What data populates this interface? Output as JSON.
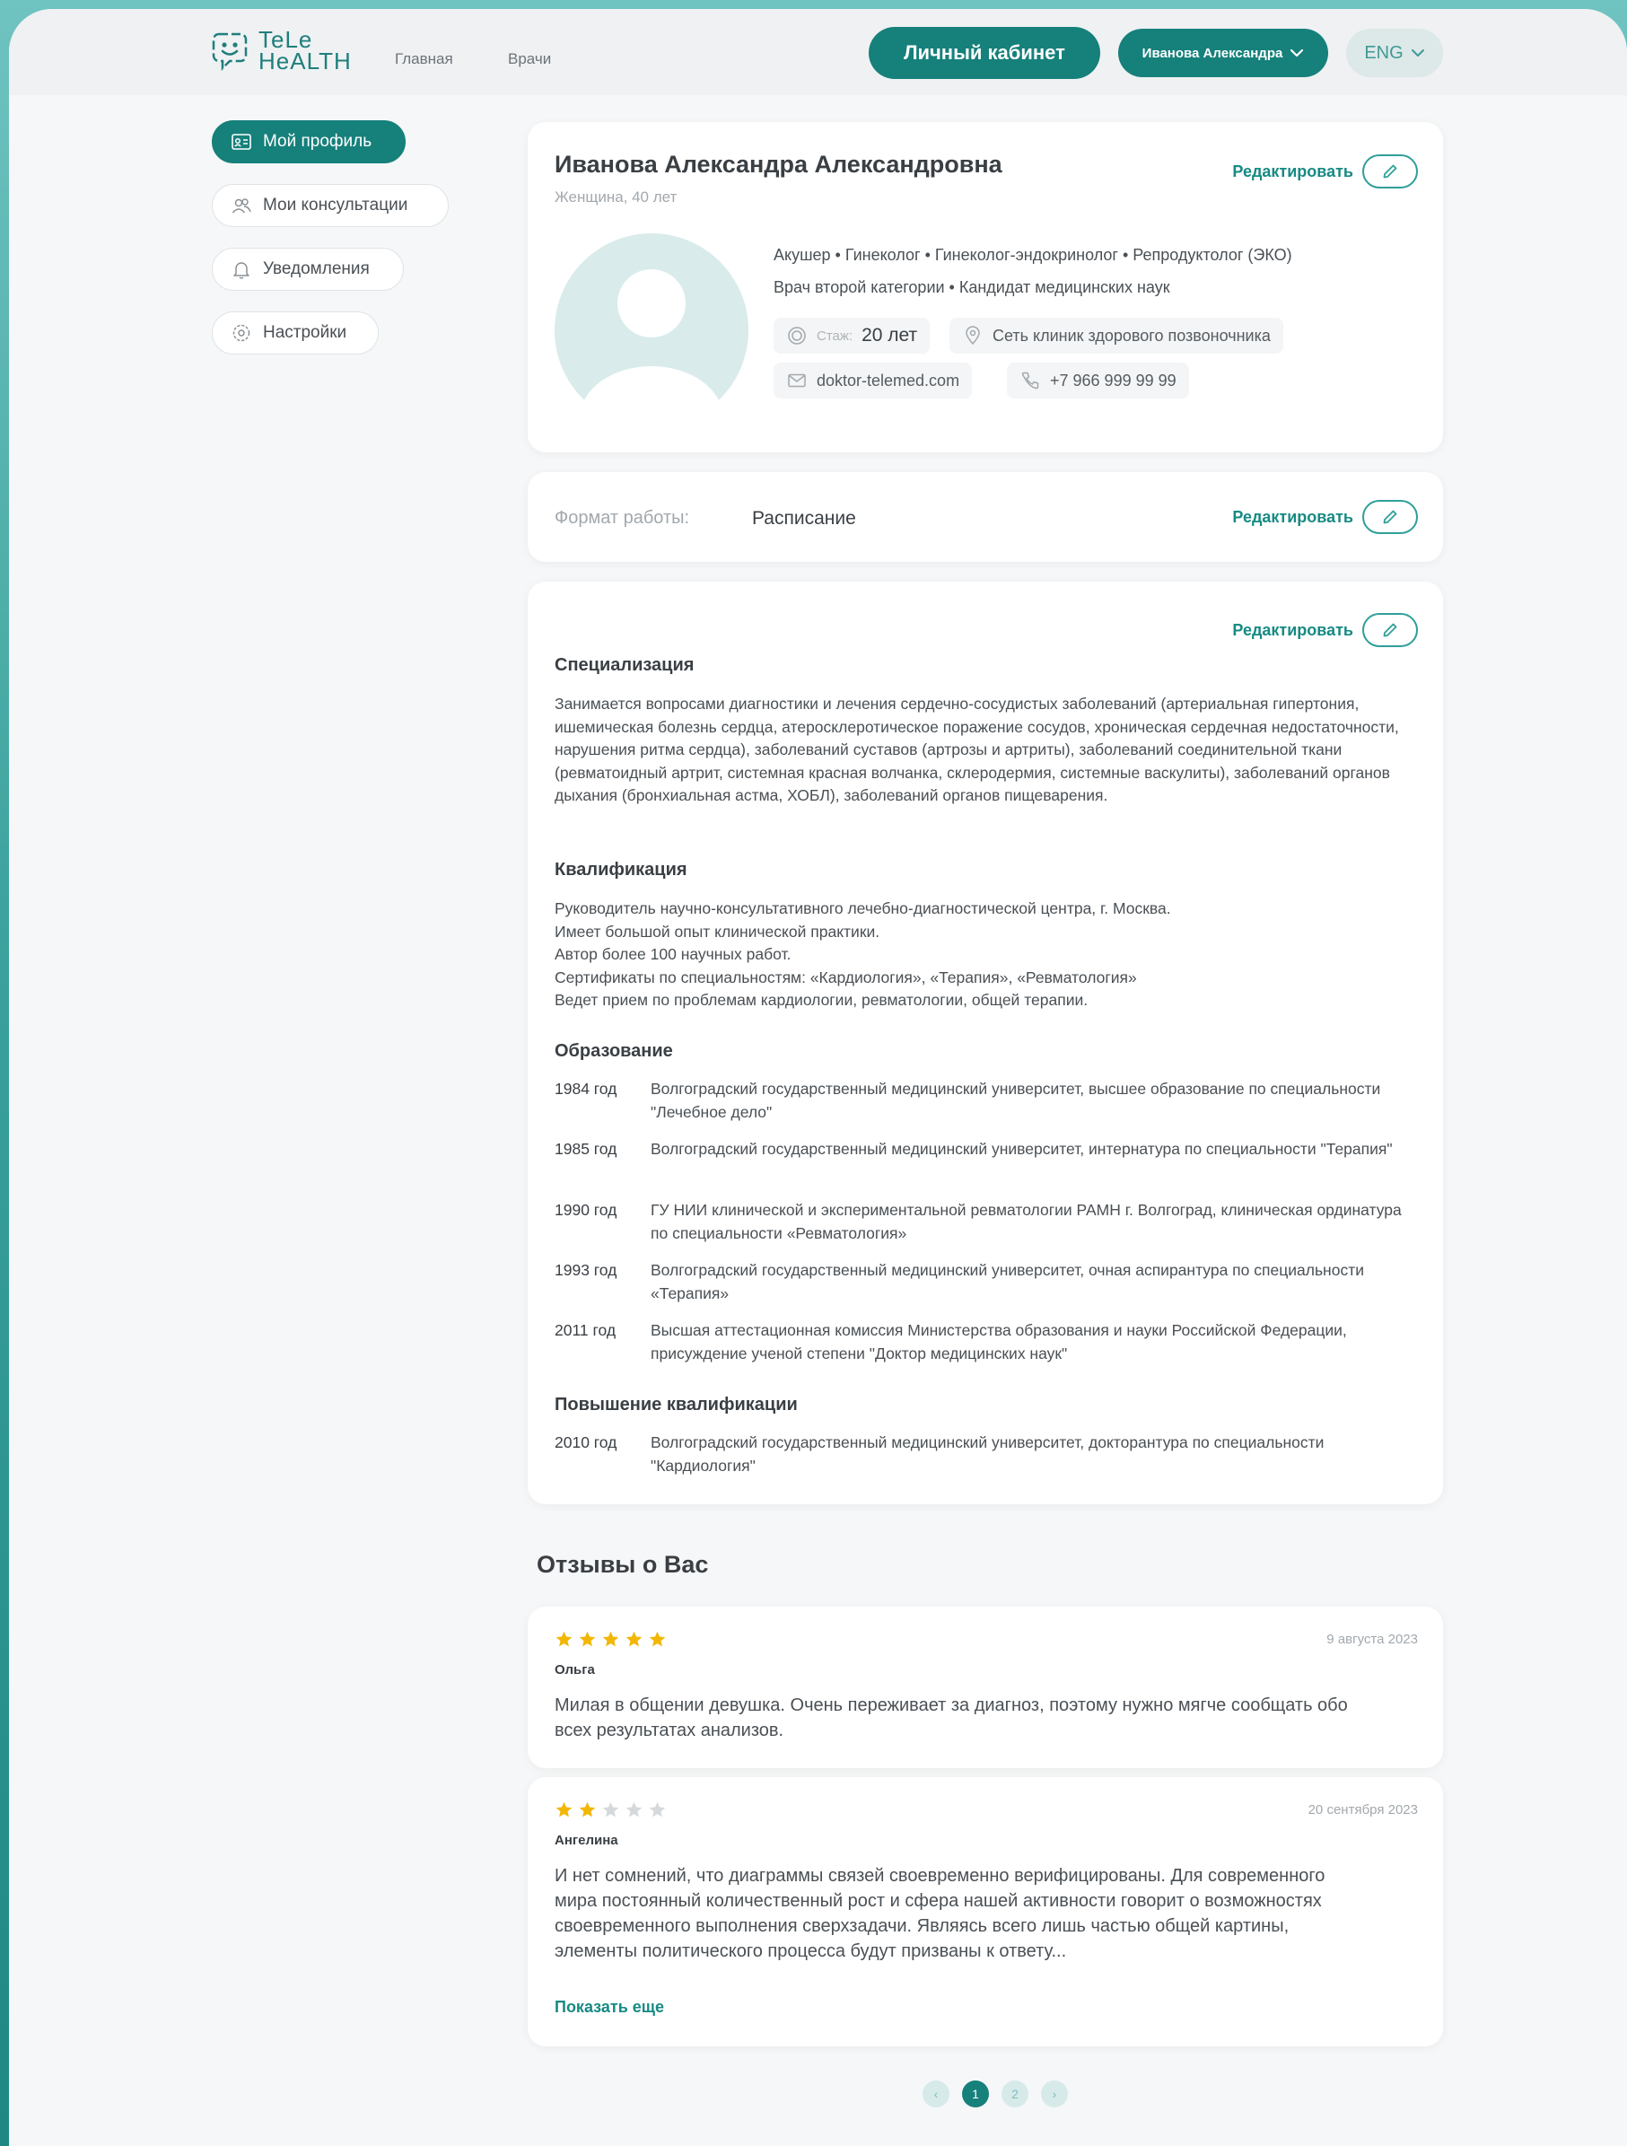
{
  "logo": {
    "line1": "TeLe",
    "line2": "HeALTH"
  },
  "nav": {
    "home": "Главная",
    "doctors": "Врачи"
  },
  "header": {
    "cabinet_label": "Личный кабинет",
    "user_label": "Иванова Александра",
    "lang_label": "ENG"
  },
  "sidebar": {
    "items": [
      {
        "label": "Мой профиль",
        "icon": "profile-card-icon"
      },
      {
        "label": "Мои консультации",
        "icon": "users-icon"
      },
      {
        "label": "Уведомления",
        "icon": "bell-icon"
      },
      {
        "label": "Настройки",
        "icon": "gear-icon"
      }
    ]
  },
  "profile": {
    "name": "Иванова Александра Александровна",
    "sub": "Женщина, 40 лет",
    "edit_label": "Редактировать",
    "specialties": "Акушер • Гинеколог • Гинеколог-эндокринолог • Репродуктолог (ЭКО)",
    "category": "Врач второй категории • Кандидат медицинских наук",
    "experience_label": "Стаж:",
    "experience_value": "20 лет",
    "clinic": "Сеть клиник здорового позвоночника",
    "site": "doktor-telemed.com",
    "phone": "+7 966 999 99 99"
  },
  "work_format": {
    "label": "Формат работы:",
    "value": "Расписание",
    "edit_label": "Редактировать"
  },
  "details": {
    "edit_label": "Редактировать",
    "specialization_title": "Специализация",
    "specialization_text": "Занимается вопросами диагностики и лечения сердечно-сосудистых заболеваний (артериальная гипертония, ишемическая болезнь сердца, атеросклеротическое поражение сосудов, хроническая сердечная недостаточности, нарушения ритма сердца), заболеваний суставов (артрозы и артриты), заболеваний соединительной ткани (ревматоидный артрит, системная красная волчанка, склеродермия, системные васкулиты), заболеваний органов дыхания (бронхиальная астма, ХОБЛ), заболеваний органов пищеварения.",
    "qualification_title": "Квалификация",
    "qualification_lines": [
      "Руководитель научно-консультативного лечебно-диагностической центра, г. Москва.",
      "Имеет большой опыт клинической практики.",
      "Автор более 100 научных работ.",
      "Сертификаты по специальностям: «Кардиология», «Терапия», «Ревматология»",
      "Ведет прием по проблемам кардиологии, ревматологии, общей терапии."
    ],
    "education_title": "Образование",
    "education": [
      {
        "year": "1984 год",
        "text": "Волгоградский государственный медицинский университет, высшее образование по специальности \"Лечебное дело\""
      },
      {
        "year": "1985 год",
        "text": "Волгоградский государственный медицинский университет, интернатура по специальности \"Терапия\""
      },
      {
        "year": "1990 год",
        "text": "ГУ НИИ клинической и экспериментальной ревматологии РАМН г. Волгоград, клиническая ординатура по специальности «Ревматология»"
      },
      {
        "year": "1993 год",
        "text": "Волгоградский государственный медицинский университет, очная аспирантура по специальности «Терапия»"
      },
      {
        "year": "2011 год",
        "text": "Высшая аттестационная комиссия Министерства образования и науки Российской Федерации, присуждение ученой степени \"Доктор медицинских наук\""
      }
    ],
    "advanced_title": "Повышение квалификации",
    "advanced": [
      {
        "year": "2010 год",
        "text": "Волгоградский государственный медицинский университет, докторантура по специальности \"Кардиология\""
      }
    ]
  },
  "reviews": {
    "title": "Отзывы о Вас",
    "star_color": "#f2b705",
    "star_empty_color": "#d6d9dc",
    "items": [
      {
        "rating": 5,
        "max": 5,
        "date": "9 августа 2023",
        "author": "Ольга",
        "text": "Милая в общении девушка. Очень переживает за диагноз, поэтому нужно мягче сообщать обо всех результатах анализов."
      },
      {
        "rating": 2,
        "max": 5,
        "date": "20 сентября 2023",
        "author": "Ангелина",
        "text": "И нет сомнений, что диаграммы связей своевременно верифицированы. Для современного мира постоянный количественный рост и сфера нашей активности говорит о возможностях своевременного выполнения сверхзадачи. Являясь всего лишь частью общей картины, элементы политического процесса будут призваны к ответу...",
        "show_more": "Показать еще"
      }
    ]
  },
  "pagination": {
    "prev": "‹",
    "pages": [
      "1",
      "2"
    ],
    "next": "›",
    "current": "1"
  },
  "colors": {
    "accent": "#16807b",
    "link": "#178a84"
  }
}
